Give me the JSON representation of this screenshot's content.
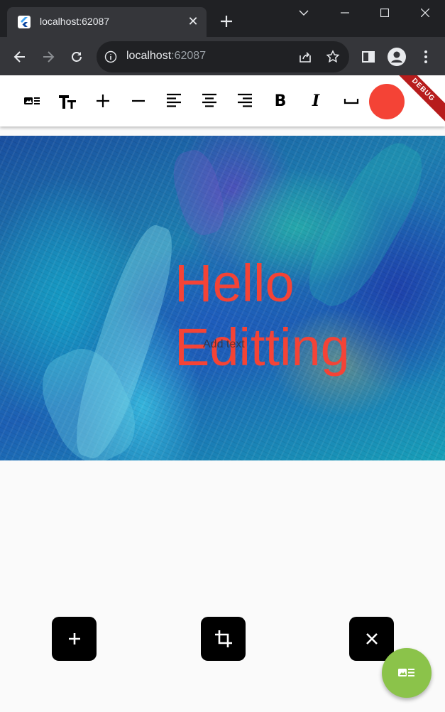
{
  "browser": {
    "tab": {
      "title": "localhost:62087",
      "close_glyph": "✕"
    },
    "address": {
      "host": "localhost",
      "port": ":62087"
    }
  },
  "editor": {
    "toolbar_icons": [
      "image-text-icon",
      "text-size-icon",
      "add-icon",
      "remove-icon",
      "align-left-icon",
      "align-center-icon",
      "align-right-icon",
      "bold-icon",
      "italic-icon",
      "space-bar-icon"
    ],
    "bold_glyph": "B",
    "italic_glyph": "I",
    "color": "#f44336",
    "debug_label": "DEBUG"
  },
  "canvas": {
    "text": "Hello\nEditting",
    "hint": "Add text",
    "text_color": "#f44336"
  },
  "actions": {
    "add_icon": "add-icon",
    "crop_icon": "crop-icon",
    "close_icon": "close-icon",
    "fab_icon": "image-text-icon",
    "fab_color": "#8bc34a"
  }
}
